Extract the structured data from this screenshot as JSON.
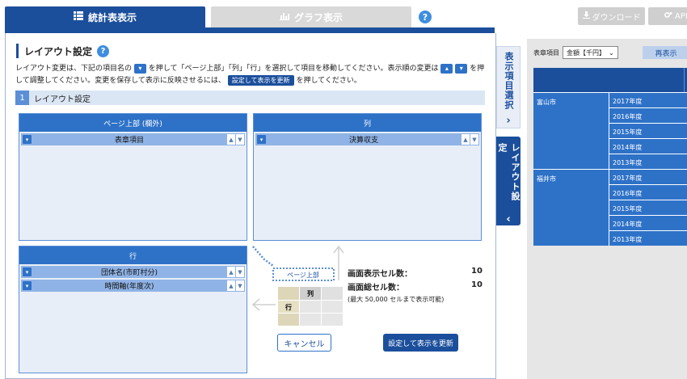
{
  "tabs": {
    "table": "統計表表示",
    "graph": "グラフ表示",
    "help": "?"
  },
  "toolbar": {
    "download": "ダウンロード",
    "api": "API"
  },
  "panel": {
    "title": "レイアウト設定",
    "help": "?",
    "desc": {
      "p1": "レイアウト変更は、下記の項目名の",
      "p2": "を押して「ページ上部」「列」「行」を選択して項目を移動してください。表示順の変更は",
      "p3": "を押して調整してください。変更を保存して表示に反映させるには、",
      "p4": "を押してください。",
      "apply_chip": "設定して表示を更新"
    },
    "section_num": "1",
    "section_title": "レイアウト設定",
    "page_top": {
      "header": "ページ上部 (欄外)",
      "items": [
        "表章項目"
      ]
    },
    "columns": {
      "header": "列",
      "items": [
        "決算収支"
      ]
    },
    "rows": {
      "header": "行",
      "items": [
        "団体名(市町村分)",
        "時間軸(年度次)"
      ]
    },
    "diagram": {
      "page_top": "ページ上部",
      "col": "列",
      "row": "行"
    },
    "counts": {
      "screen_label": "画面表示セル数：",
      "screen_value": "10",
      "total_label": "画面総セル数：",
      "total_value": "10",
      "note": "(最大 50,000 セルまで表示可能)"
    },
    "cancel": "キャンセル",
    "apply": "設定して表示を更新"
  },
  "side_tabs": {
    "item_select": "表示項目選択",
    "layout": "レイアウト設定"
  },
  "right": {
    "filter_label": "表章項目",
    "filter_value": "金額【千円】",
    "refresh": "再表示",
    "groups": [
      {
        "city": "富山市",
        "years": [
          "2017年度",
          "2016年度",
          "2015年度",
          "2014年度",
          "2013年度"
        ]
      },
      {
        "city": "福井市",
        "years": [
          "2017年度",
          "2016年度",
          "2015年度",
          "2014年度",
          "2013年度"
        ]
      }
    ]
  }
}
